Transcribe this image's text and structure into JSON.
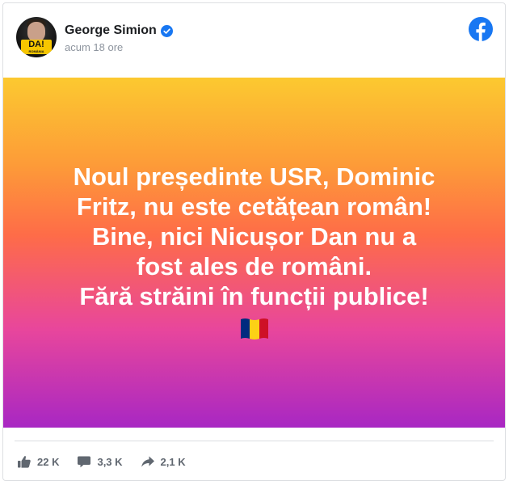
{
  "post": {
    "author": {
      "name": "George Simion",
      "verified": true,
      "avatar_banner_text": "DA!",
      "avatar_banner_subtext": "ROMÂNIA"
    },
    "timestamp": "acum 18 ore",
    "platform_icon": "facebook-logo-icon",
    "status": {
      "text": "Noul președinte USR, Dominic\nFritz, nu este cetățean român!\nBine, nici Nicușor Dan nu a\nfost ales de români.\nFără străini în funcții publice!",
      "emoji": "romania-flag-icon",
      "flag_colors": [
        "#002b7f",
        "#fcd116",
        "#ce1126"
      ],
      "background_gradient": [
        "#fcc930",
        "#fe6c48",
        "#a827c3"
      ]
    },
    "stats": {
      "likes": "22 K",
      "comments": "3,3 K",
      "shares": "2,1 K"
    }
  },
  "colors": {
    "brand": "#1877f2",
    "text_primary": "#1c1e21",
    "text_secondary": "#8d949e",
    "stats_text": "#606770"
  }
}
